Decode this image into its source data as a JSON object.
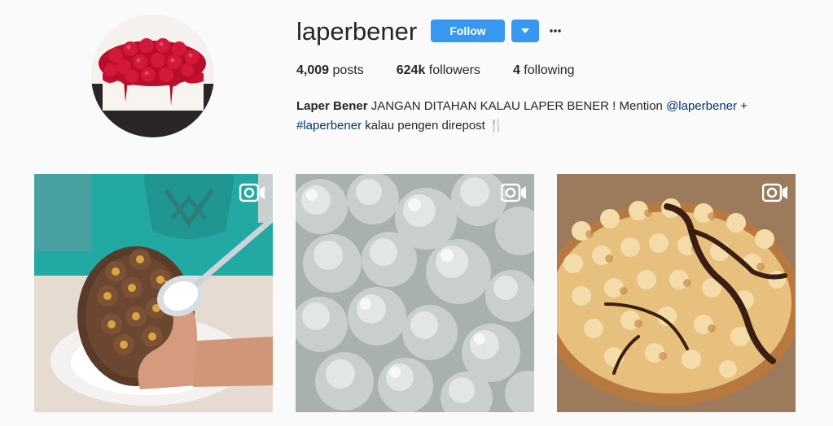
{
  "profile": {
    "username": "laperbener",
    "follow_label": "Follow",
    "dropdown_icon": "caret-down-icon",
    "more_icon": "ellipsis-icon",
    "accent_color": "#3897f0"
  },
  "stats": {
    "posts_count": "4,009",
    "posts_label": "posts",
    "followers_count": "624k",
    "followers_label": "followers",
    "following_count": "4",
    "following_label": "following"
  },
  "bio": {
    "full_name": "Laper Bener",
    "text_1": "JANGAN DITAHAN KALAU LAPER BENER ! Mention",
    "mention": "@laperbener",
    "plus": "+",
    "hashtag": "#laperbener",
    "text_2": "kalau pengen direpost",
    "emoji": "🍴"
  },
  "posts": [
    {
      "type": "video",
      "subject": "chocolate egg with ferrero rocher and spoon"
    },
    {
      "type": "video",
      "subject": "white steamed rice cakes"
    },
    {
      "type": "video",
      "subject": "toasted marshmallow pizza with chocolate drizzle"
    }
  ]
}
